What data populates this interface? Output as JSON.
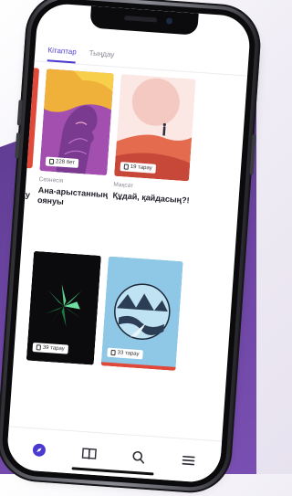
{
  "tabs": [
    {
      "label": "Кітаптар",
      "active": true
    },
    {
      "label": "Тыңдау",
      "active": false
    }
  ],
  "books": [
    {
      "badge": "228 бет",
      "genre": "Cөзнесія",
      "title_line1": "Ана-арыстанның",
      "title_line2": "оянуы",
      "art": "face-profile"
    },
    {
      "badge": "19 тарау",
      "genre": "Мақсат",
      "title_line1": "Құдай, қайдасың?!",
      "art": "mountain-figure"
    },
    {
      "badge": "39 тарау",
      "art": "green-leaves"
    },
    {
      "badge": "33 тарау",
      "art": "river-landscape"
    }
  ],
  "partial_title": "қу",
  "nav": {
    "items": [
      "compass-icon",
      "book-icon",
      "search-icon",
      "menu-icon"
    ],
    "active": "compass-icon"
  },
  "colors": {
    "accent": "#4a3ad1",
    "background_purple": "#6d45a4"
  }
}
